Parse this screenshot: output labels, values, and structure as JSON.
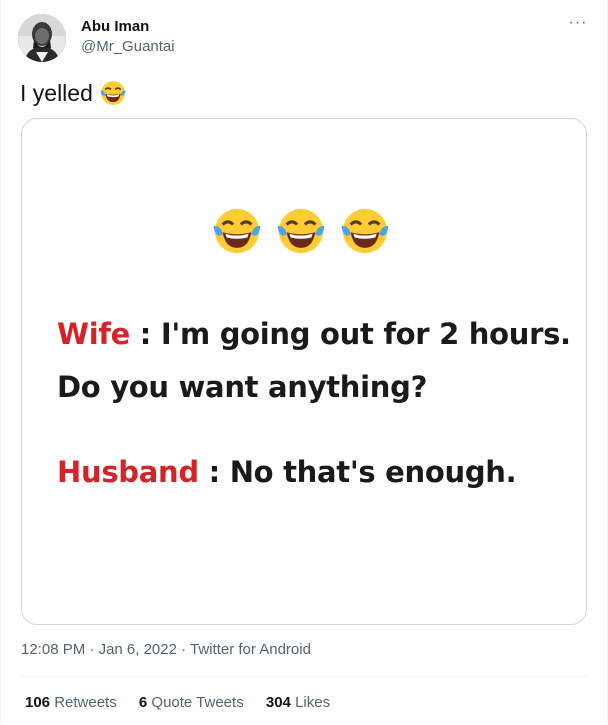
{
  "author": {
    "display_name": "Abu Iman",
    "handle": "@Mr_Guantai"
  },
  "more_menu": "···",
  "tweet": {
    "text": "I yelled",
    "emoji": "face-with-tears-of-joy"
  },
  "media": {
    "emoji_icons": [
      "face-with-tears-of-joy",
      "face-with-tears-of-joy",
      "face-with-tears-of-joy"
    ],
    "line1_speaker": "Wife",
    "line1_text": " : I'm going out for 2 hours.",
    "line2_text": "Do you want anything?",
    "line3_speaker": "Husband",
    "line3_text": " : No that's enough.",
    "speaker_color": "#d6232a"
  },
  "meta": {
    "time": "12:08 PM",
    "separator": " · ",
    "date": "Jan 6, 2022",
    "source": "Twitter for Android"
  },
  "stats": {
    "retweets_count": "106",
    "retweets_label": " Retweets",
    "quotes_count": "6",
    "quotes_label": " Quote Tweets",
    "likes_count": "304",
    "likes_label": " Likes"
  }
}
